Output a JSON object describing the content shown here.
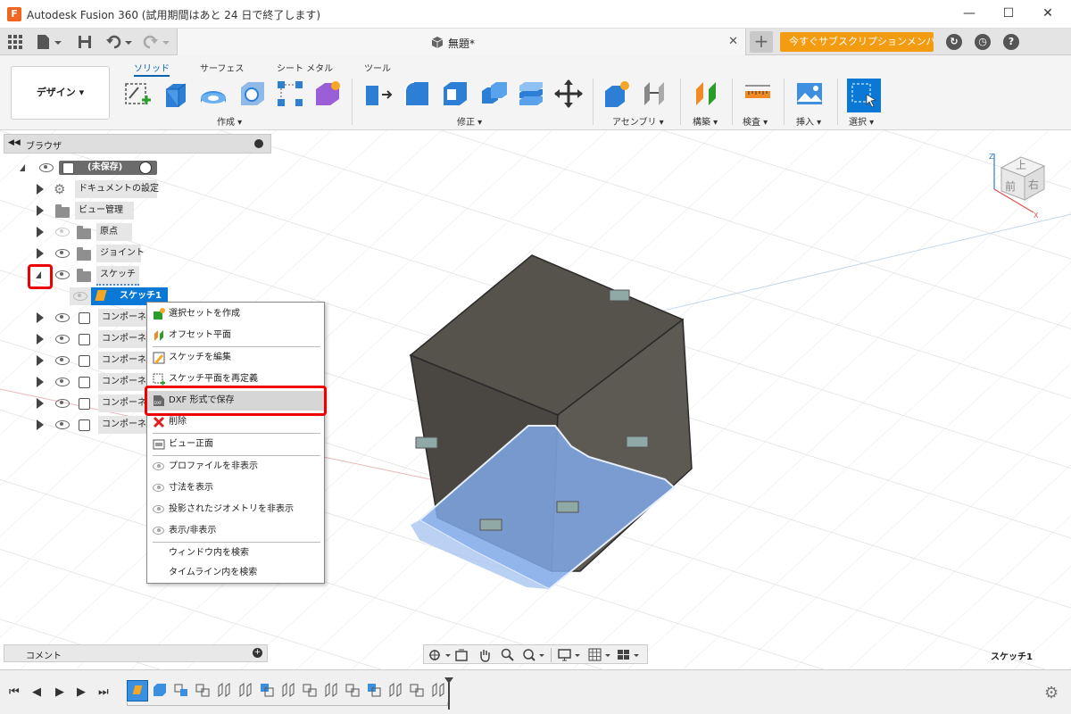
{
  "window": {
    "app_icon_letter": "F",
    "title": "Autodesk Fusion 360 (試用期間はあと 24 日で終了します)",
    "minimize": "—",
    "maximize": "☐",
    "close": "✕"
  },
  "tabbar": {
    "doc_title": "無題*",
    "close_tab": "✕",
    "new_tab": "+",
    "promo_button": "今すぐサブスクリプションメンバーに..."
  },
  "ribbon": {
    "workspace": "デザイン ▾",
    "tabs": [
      "ソリッド",
      "サーフェス",
      "シート メタル",
      "ツール"
    ],
    "groups": [
      "作成 ▾",
      "修正 ▾",
      "アセンブリ ▾",
      "構築 ▾",
      "検査 ▾",
      "挿入 ▾",
      "選択 ▾"
    ]
  },
  "browser": {
    "title": "ブラウザ",
    "root": "(未保存)",
    "items": [
      "ドキュメントの設定",
      "ビュー管理",
      "原点",
      "ジョイント",
      "スケッチ"
    ],
    "sketch_child": "スケッチ1",
    "components": [
      "コンポーネ",
      "コンポーネ",
      "コンポーネ",
      "コンポーネ",
      "コンポーネ",
      "コンポーネ"
    ]
  },
  "context_menu": {
    "items": [
      "選択セットを作成",
      "オフセット平面",
      "スケッチを編集",
      "スケッチ平面を再定義",
      "DXF 形式で保存",
      "削除",
      "ビュー正面",
      "プロファイルを非表示",
      "寸法を表示",
      "投影されたジオメトリを非表示",
      "表示/非表示",
      "ウィンドウ内を検索",
      "タイムライン内を検索"
    ],
    "highlighted": "DXF 形式で保存"
  },
  "viewcube": {
    "top": "上",
    "front": "前",
    "right": "右"
  },
  "bottom": {
    "comment": "コメント",
    "active_sketch": "スケッチ1"
  },
  "colors": {
    "accent": "#0a64ad",
    "promo": "#f39c12",
    "highlight_red": "#e00000",
    "box_face": "#5a5650",
    "sketch_blue": "#7fa8e8"
  }
}
